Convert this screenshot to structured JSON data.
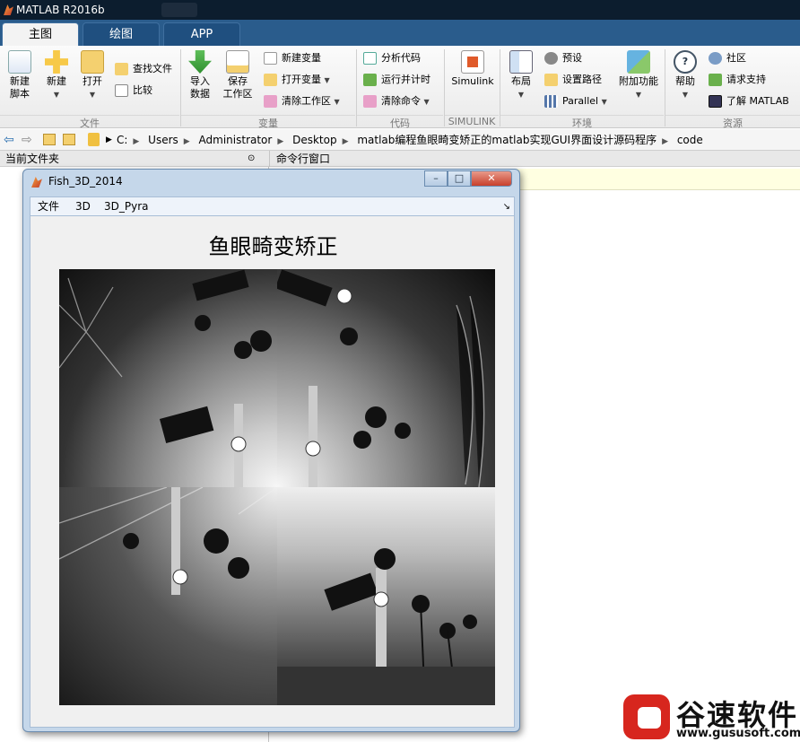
{
  "app": {
    "title": "MATLAB R2016b"
  },
  "tabs": [
    {
      "label": "主图"
    },
    {
      "label": "绘图"
    },
    {
      "label": "APP"
    }
  ],
  "ribbon": {
    "file": {
      "new_script": "新建\n脚本",
      "new": "新建",
      "open": "打开",
      "find_files": "查找文件",
      "compare": "比较",
      "group": "文件"
    },
    "variable": {
      "import": "导入\n数据",
      "save_ws": "保存\n工作区",
      "new_var": "新建变量",
      "open_var": "打开变量",
      "clear_ws": "清除工作区",
      "group": "变量"
    },
    "code": {
      "analyze": "分析代码",
      "run_time": "运行并计时",
      "clear_cmd": "清除命令",
      "group": "代码"
    },
    "simulink": {
      "btn": "Simulink",
      "group": "SIMULINK"
    },
    "env": {
      "layout": "布局",
      "prefs": "预设",
      "set_path": "设置路径",
      "parallel": "Parallel",
      "addons": "附加功能",
      "group": "环境"
    },
    "resources": {
      "help": "帮助",
      "community": "社区",
      "support": "请求支持",
      "learn": "了解 MATLAB",
      "group": "资源"
    }
  },
  "address": {
    "crumbs": [
      "C:",
      "Users",
      "Administrator",
      "Desktop",
      "matlab编程鱼眼畸变矫正的matlab实现GUI界面设计源码程序",
      "code"
    ]
  },
  "panels": {
    "current_folder": "当前文件夹",
    "command_window": "命令行窗口"
  },
  "figure": {
    "title": "Fish_3D_2014",
    "menu": [
      "文件",
      "3D",
      "3D_Pyra"
    ],
    "heading": "鱼眼畸变矫正"
  },
  "watermark": {
    "name": "谷速软件",
    "url": "www.gususoft.com"
  },
  "colors": {
    "accent": "#2a5c8c",
    "brand_red": "#d7261e"
  }
}
